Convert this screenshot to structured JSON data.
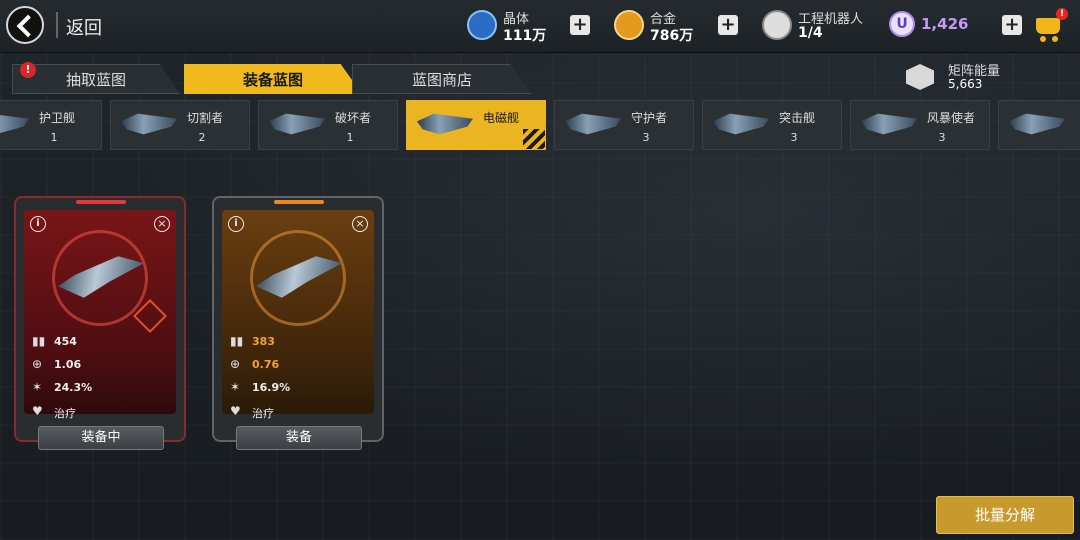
{
  "header": {
    "back_label": "返回",
    "resources": [
      {
        "name": "晶体",
        "value": "111万",
        "icon": "crystal-icon"
      },
      {
        "name": "合金",
        "value": "786万",
        "icon": "alloy-icon"
      },
      {
        "name": "工程机器人",
        "value": "1/4",
        "icon": "robot-icon"
      }
    ],
    "premium": {
      "symbol": "U",
      "value": "1,426",
      "color": "#c49af5"
    },
    "cart_badge": "!"
  },
  "tabs": [
    {
      "label": "抽取蓝图",
      "alert": "!"
    },
    {
      "label": "装备蓝图",
      "active": true
    },
    {
      "label": "蓝图商店"
    }
  ],
  "matrix_energy": {
    "label": "矩阵能量",
    "value": "5,663"
  },
  "categories": [
    {
      "name": "护卫舰",
      "count": "1"
    },
    {
      "name": "切割者",
      "count": "2"
    },
    {
      "name": "破坏者",
      "count": "1"
    },
    {
      "name": "电磁舰",
      "count": "",
      "active": true
    },
    {
      "name": "守护者",
      "count": "3"
    },
    {
      "name": "突击舰",
      "count": "3"
    },
    {
      "name": "风暴使者",
      "count": "3"
    },
    {
      "name": "",
      "count": ""
    }
  ],
  "cards": [
    {
      "theme": "red",
      "info": "i",
      "close": "×",
      "stats": {
        "ammo": "454",
        "accuracy": "1.06",
        "crit": "24.3%",
        "heal": "治疗"
      },
      "button": "装备中"
    },
    {
      "theme": "orange",
      "info": "i",
      "close": "×",
      "stats": {
        "ammo": "383",
        "accuracy": "0.76",
        "crit": "16.9%",
        "heal": "治疗"
      },
      "button": "装备"
    }
  ],
  "decompose_button": "批量分解",
  "colors": {
    "accent": "#f0ba1f",
    "red_theme": "#7a1518",
    "orange_theme": "#6a3e10",
    "button_gold": "#c89a2e"
  }
}
